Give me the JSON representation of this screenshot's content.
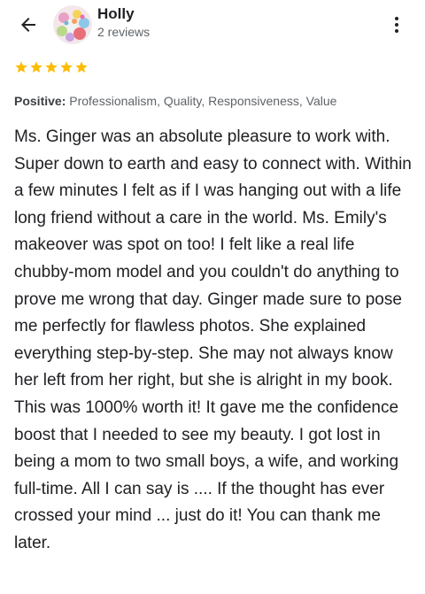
{
  "reviewer": {
    "name": "Holly",
    "review_count": "2 reviews"
  },
  "rating": {
    "stars": 5,
    "max": 5,
    "color": "#fbbc04"
  },
  "attributes": {
    "label": "Positive:",
    "values": "Professionalism, Quality, Responsiveness, Value"
  },
  "review": {
    "text": "Ms. Ginger was an absolute pleasure to work with. Super down to earth and easy to connect with. Within a few minutes I felt as if I was hanging out with a life long friend without a care in the world. Ms. Emily's makeover was spot on too! I felt like a real life chubby-mom model and you couldn't do anything to prove me wrong that day. Ginger made sure to pose me perfectly for flawless photos. She explained everything step-by-step. She may not always know her left from her right, but she is alright in my book. This was 1000% worth it! It gave me the confidence boost that I needed to see my beauty. I got lost in being a mom to two small boys, a wife, and working full-time. All I can say is .... If the thought has ever crossed your mind ... just do it! You can thank me later."
  },
  "icons": {
    "back": "arrow-left-icon",
    "more": "more-vert-icon",
    "star": "star-icon"
  }
}
